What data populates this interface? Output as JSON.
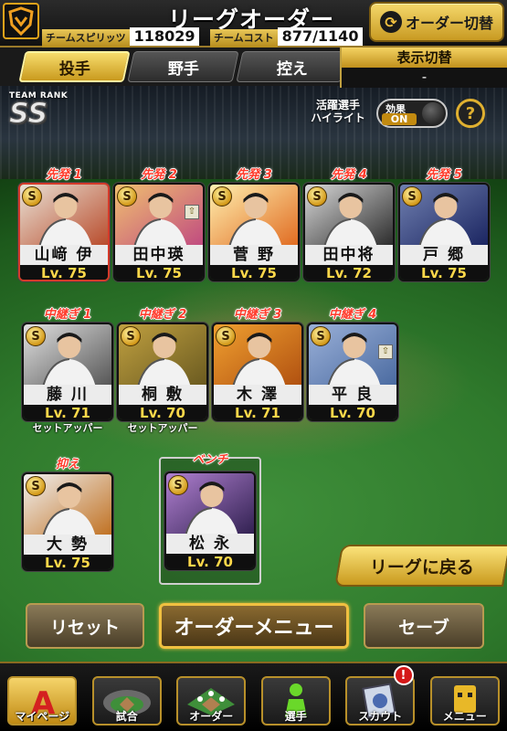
{
  "header": {
    "title": "リーグオーダー",
    "team_spirit_label": "チームスピリッツ",
    "team_spirit_value": "118029",
    "team_cost_label": "チームコスト",
    "team_cost_value": "877/1140",
    "order_switch_label": "オーダー切替"
  },
  "tabs": [
    {
      "label": "投手",
      "active": true
    },
    {
      "label": "野手",
      "active": false
    },
    {
      "label": "控え",
      "active": false
    }
  ],
  "display_toggle": {
    "title": "表示切替",
    "value": "-"
  },
  "team_rank": {
    "label": "TEAM RANK",
    "value": "SS"
  },
  "highlight": {
    "label_line1": "活躍選手",
    "label_line2": "ハイライト",
    "effect_label": "効果",
    "effect_state": "ON",
    "help_glyph": "?"
  },
  "starters": [
    {
      "slot": "先発 1",
      "name": "山﨑 伊",
      "level": "Lv. 75",
      "badge": "S",
      "colors": [
        "#e9e2d6",
        "#b84a2a"
      ]
    },
    {
      "slot": "先発 2",
      "name": "田中瑛",
      "level": "Lv. 75",
      "badge": "S",
      "colors": [
        "#f0c070",
        "#c04a80"
      ]
    },
    {
      "slot": "先発 3",
      "name": "菅 野",
      "level": "Lv. 75",
      "badge": "S",
      "colors": [
        "#fff0b0",
        "#e06a20"
      ]
    },
    {
      "slot": "先発 4",
      "name": "田中将",
      "level": "Lv. 72",
      "badge": "S",
      "colors": [
        "#d8d8d8",
        "#2a2a2a"
      ]
    },
    {
      "slot": "先発 5",
      "name": "戸 郷",
      "level": "Lv. 75",
      "badge": "S",
      "colors": [
        "#7080b0",
        "#1a2460"
      ]
    }
  ],
  "relievers": [
    {
      "slot": "中継ぎ 1",
      "name": "藤 川",
      "level": "Lv. 71",
      "badge": "S",
      "sub": "セットアッパー",
      "colors": [
        "#e0e0e0",
        "#555555"
      ]
    },
    {
      "slot": "中継ぎ 2",
      "name": "桐 敷",
      "level": "Lv. 70",
      "badge": "S",
      "sub": "セットアッパー",
      "colors": [
        "#c0a040",
        "#6a5a20"
      ]
    },
    {
      "slot": "中継ぎ 3",
      "name": "木 澤",
      "level": "Lv. 71",
      "badge": "S",
      "sub": "",
      "colors": [
        "#f0a030",
        "#b05010"
      ]
    },
    {
      "slot": "中継ぎ 4",
      "name": "平 良",
      "level": "Lv. 70",
      "badge": "S",
      "sub": "",
      "colors": [
        "#9ab0d8",
        "#4a6aa0"
      ]
    }
  ],
  "closer": {
    "slot": "抑え",
    "name": "大 勢",
    "level": "Lv. 75",
    "badge": "S",
    "colors": [
      "#f0f0f0",
      "#c07020"
    ]
  },
  "bench": {
    "slot": "ベンチ",
    "name": "松 永",
    "level": "Lv. 70",
    "badge": "S",
    "colors": [
      "#b080d0",
      "#302050"
    ]
  },
  "buttons": {
    "back_to_league": "リーグに戻る",
    "reset": "リセット",
    "order_menu": "オーダーメニュー",
    "save": "セーブ"
  },
  "footer_nav": [
    {
      "label": "マイページ",
      "icon": "mypage-icon",
      "active": true
    },
    {
      "label": "試合",
      "icon": "stadium-icon",
      "active": false
    },
    {
      "label": "オーダー",
      "icon": "field-icon",
      "active": false
    },
    {
      "label": "選手",
      "icon": "player-icon",
      "active": false
    },
    {
      "label": "スカウト",
      "icon": "scout-icon",
      "active": false,
      "badge": "!"
    },
    {
      "label": "メニュー",
      "icon": "menu-icon",
      "active": false
    }
  ]
}
